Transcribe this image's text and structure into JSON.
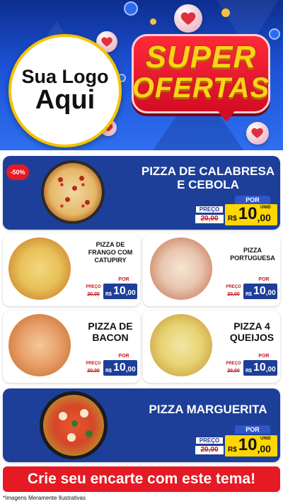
{
  "header": {
    "logo_line1": "Sua Logo",
    "logo_line2": "Aqui",
    "badge_line1": "SUPER",
    "badge_line2": "OFERTAS"
  },
  "colors": {
    "brand_blue": "#1d3f9a",
    "accent_red": "#e51a24",
    "accent_yellow": "#ffd700"
  },
  "products": [
    {
      "name": "PIZZA DE CALABRESA E CEBOLA",
      "discount": "-50%",
      "por": "POR",
      "preco_label": "PREÇO",
      "old": "20,00",
      "currency": "R$",
      "price_int": "10",
      "price_cents": ",00",
      "unit": "UNID"
    },
    {
      "name": "PIZZA DE FRANGO COM CATUPIRY",
      "por": "POR",
      "preco_label": "PREÇO",
      "old": "20,00",
      "currency": "R$",
      "price_int": "10",
      "price_cents": ",00",
      "unit": "UNID"
    },
    {
      "name": "PIZZA PORTUGUESA",
      "por": "POR",
      "preco_label": "PREÇO",
      "old": "20,00",
      "currency": "R$",
      "price_int": "10",
      "price_cents": ",00",
      "unit": "UNID"
    },
    {
      "name": "PIZZA DE BACON",
      "por": "POR",
      "preco_label": "PREÇO",
      "old": "20,00",
      "currency": "R$",
      "price_int": "10",
      "price_cents": ",00",
      "unit": "UNID"
    },
    {
      "name": "PIZZA 4 QUEIJOS",
      "por": "POR",
      "preco_label": "PREÇO",
      "old": "20,00",
      "currency": "R$",
      "price_int": "10",
      "price_cents": ",00",
      "unit": "UNID"
    },
    {
      "name": "PIZZA MARGUERITA",
      "por": "POR",
      "preco_label": "PREÇO",
      "old": "20,00",
      "currency": "R$",
      "price_int": "10",
      "price_cents": ",00",
      "unit": "UNID"
    }
  ],
  "cta": "Crie seu encarte com este tema!",
  "note": "*Imagens Meramente Ilustrativas"
}
